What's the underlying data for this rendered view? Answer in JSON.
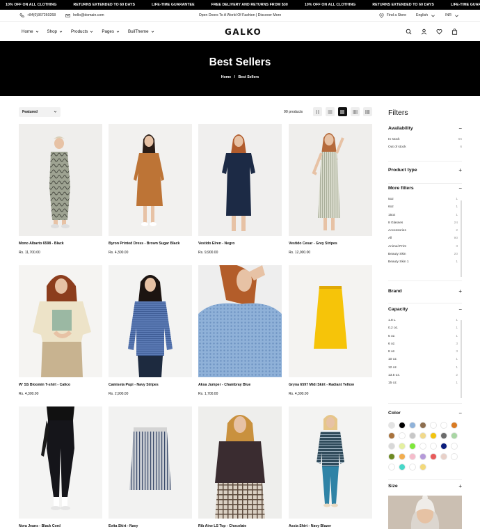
{
  "marquee": {
    "items": [
      "10% OFF ON ALL CLOTHING",
      "RETURNS EXTENDED TO 60 DAYS",
      "LIFE-TIME GUARANTEE",
      "FREE DELIVERY AND RETURNS FROM $30",
      "10% OFF ON ALL CLOTHING",
      "RETURNS EXTENDED TO 60 DAYS",
      "LIFE-TIME GUARANTEE",
      "FREE DELIVERY AND RETURNS FROM $30"
    ]
  },
  "utility": {
    "phone": "+84(0)367260268",
    "email": "hello@domain.com",
    "announcement": "Open Doors To A World Of Fashion | Discover More",
    "find_store": "Find a Store",
    "language": "English",
    "currency": "INR"
  },
  "nav": {
    "items": [
      "Home",
      "Shop",
      "Products",
      "Pages",
      "BuilTheme"
    ],
    "logo": "GALKO"
  },
  "hero": {
    "title": "Best Sellers",
    "crumb_home": "Home",
    "crumb_sep": "/",
    "crumb_current": "Best Sellers"
  },
  "toolbar": {
    "sort_value": "Featured",
    "count": "90 products"
  },
  "products": [
    {
      "name": "Mono Albarto 6598 - Black",
      "price": "Rs. 11,700.00"
    },
    {
      "name": "Byron Printed Dress - Brown Sugar Black",
      "price": "Rs. 4,300.00"
    },
    {
      "name": "Vestido Elren - Negro",
      "price": "Rs. 9,900.00"
    },
    {
      "name": "Vestido Cesar - Grey Stripes",
      "price": "Rs. 12,000.00"
    },
    {
      "name": "W' SS Bloomin T-shirt - Calico",
      "price": "Rs. 4,300.00"
    },
    {
      "name": "Camiseta Pupi - Navy Stripes",
      "price": "Rs. 2,900.00"
    },
    {
      "name": "Aksa Jumper - Chambray Blue",
      "price": "Rs. 1,700.00"
    },
    {
      "name": "Gryna 6597 Midi Skirt - Radiant Yellow",
      "price": "Rs. 4,300.00"
    },
    {
      "name": "Nora Jeans - Black Cord",
      "price": ""
    },
    {
      "name": "Evita Skirt - Navy",
      "price": ""
    },
    {
      "name": "Rib Aine LS Top - Chocolate",
      "price": ""
    },
    {
      "name": "Assia Shirt - Navy Blazer",
      "price": ""
    }
  ],
  "filters": {
    "title": "Filters",
    "availability": {
      "label": "Availability",
      "toggle": "−",
      "rows": [
        {
          "label": "In stock",
          "count": "66"
        },
        {
          "label": "Out of stock",
          "count": "6"
        }
      ]
    },
    "product_type": {
      "label": "Product type",
      "toggle": "+"
    },
    "more_filters": {
      "label": "More filters",
      "toggle": "−",
      "rows": [
        {
          "label": "5oz",
          "count": "1"
        },
        {
          "label": "6oz",
          "count": "1"
        },
        {
          "label": "15oz",
          "count": "1"
        },
        {
          "label": "8 Glasses",
          "count": "24"
        },
        {
          "label": "Accessories",
          "count": "2"
        },
        {
          "label": "All",
          "count": "90"
        },
        {
          "label": "Animal Print",
          "count": "3"
        },
        {
          "label": "Beauty Skin",
          "count": "20"
        },
        {
          "label": "Beauty Skin 1",
          "count": "1"
        }
      ]
    },
    "brand": {
      "label": "Brand",
      "toggle": "+"
    },
    "capacity": {
      "label": "Capacity",
      "toggle": "−",
      "rows": [
        {
          "label": "1.8 L",
          "count": "1"
        },
        {
          "label": "0.2 oz.",
          "count": "1"
        },
        {
          "label": "5 oz.",
          "count": "1"
        },
        {
          "label": "6 oz.",
          "count": "3"
        },
        {
          "label": "8 oz.",
          "count": "3"
        },
        {
          "label": "10 oz.",
          "count": "1"
        },
        {
          "label": "12 oz.",
          "count": "1"
        },
        {
          "label": "13.5 oz.",
          "count": "2"
        },
        {
          "label": "15 oz.",
          "count": "1"
        }
      ]
    },
    "color": {
      "label": "Color",
      "toggle": "−",
      "swatches": [
        "#e3e3e3",
        "#000000",
        "#8fb2d9",
        "#8d6e4f",
        "#ffffff",
        "#ffffff",
        "#d97a22",
        "#a8723c",
        "#ffffff",
        "#c7c7c7",
        "#f1d98a",
        "#f2c40f",
        "#6b6b6b",
        "#a9d6a4",
        "#d8d8d8",
        "#e4f0a0",
        "#7ee83a",
        "#ffffff",
        "#ffffff",
        "#0a1c7c",
        "#ffffff",
        "#6d8a22",
        "#f2ad4e",
        "#f5bccb",
        "#b59ad9",
        "#e85b5b",
        "#e8d0c8",
        "#ffffff",
        "#ffffff",
        "#47d8c9",
        "#ffffff",
        "#f3d97a"
      ]
    },
    "size": {
      "label": "Size",
      "toggle": "+"
    }
  }
}
